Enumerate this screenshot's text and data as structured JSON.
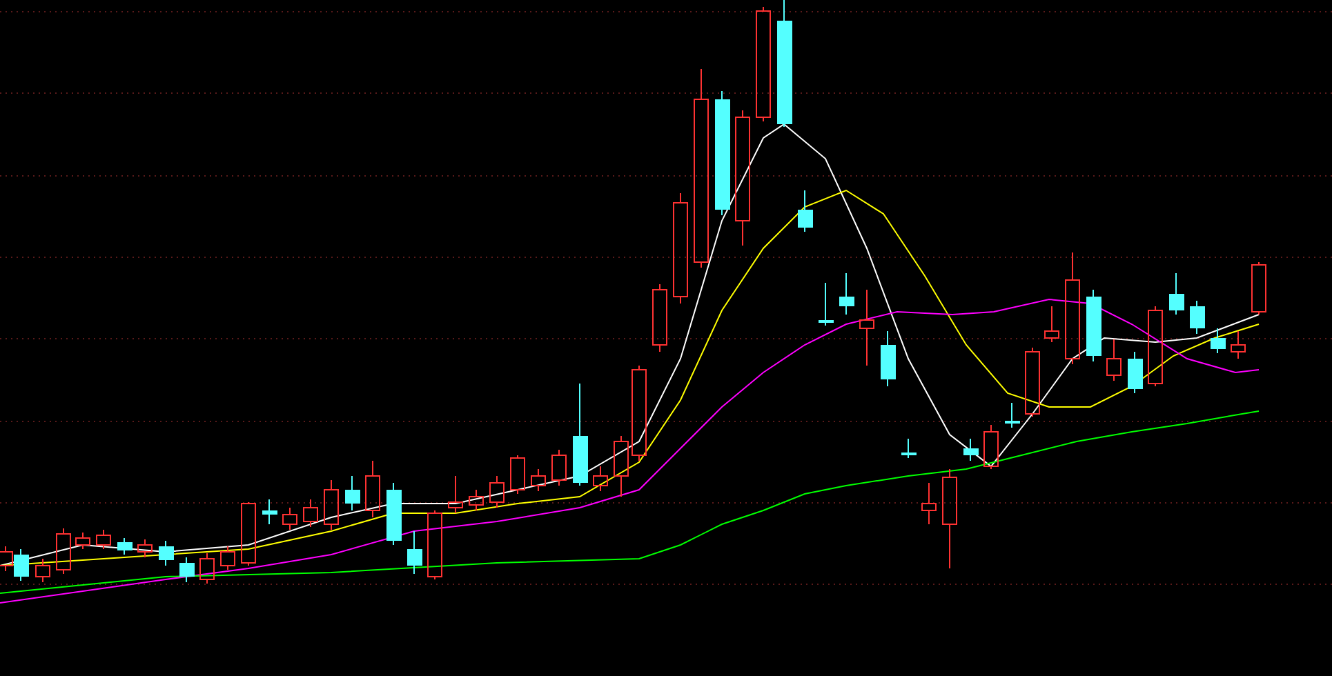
{
  "moving_averages": [
    {
      "color": "#ffffff"
    },
    {
      "color": "#ffff00"
    },
    {
      "color": "#ff00ff"
    },
    {
      "color": "#00ff00"
    }
  ]
}
